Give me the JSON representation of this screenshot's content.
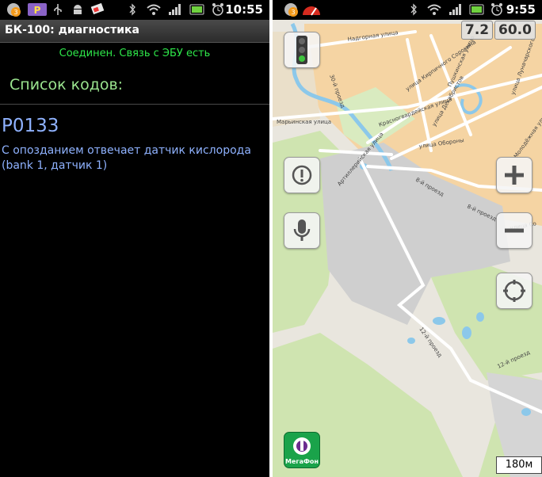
{
  "left": {
    "clock": "10:55",
    "title": "БК-100: диагностика",
    "connection_status": "Соединен. Связь с ЭБУ есть",
    "codes_heading": "Список кодов:",
    "codes": [
      {
        "code": "P0133",
        "description": "С опозданием отвечает датчик кислорода (bank 1, датчик 1)"
      }
    ],
    "colors": {
      "status_green": "#2ee84a",
      "heading_green": "#9be58f",
      "code_blue": "#8fb2ff"
    }
  },
  "right": {
    "clock": "9:55",
    "speed_value": "7.2",
    "speed_limit": "60.0",
    "scale_label": "180м",
    "operator_logo_text": "МегаФон",
    "streets": [
      "Надгорная улица",
      "улица Кирпичного Сорокина",
      "Пушкинская улица",
      "улица Луначарского",
      "30-й проезд",
      "Красногвардейская улица",
      "улица Декабристов",
      "Марьинская улица",
      "улица Обороны",
      "Артиллерийская улица",
      "8-й проезд",
      "8-й проезд",
      "улица Со",
      "12-й проезд",
      "12-й проезд",
      "Молодёжная улица"
    ]
  },
  "icons": [
    "notification-badge-icon",
    "parking-icon",
    "usb-icon",
    "android-debug-icon",
    "gps-flag-icon",
    "bluetooth-icon",
    "wifi-icon",
    "signal-icon",
    "battery-icon",
    "alarm-icon",
    "traffic-light-icon",
    "alert-icon",
    "microphone-icon",
    "zoom-in-icon",
    "zoom-out-icon",
    "gps-locate-icon",
    "speedometer-icon"
  ]
}
